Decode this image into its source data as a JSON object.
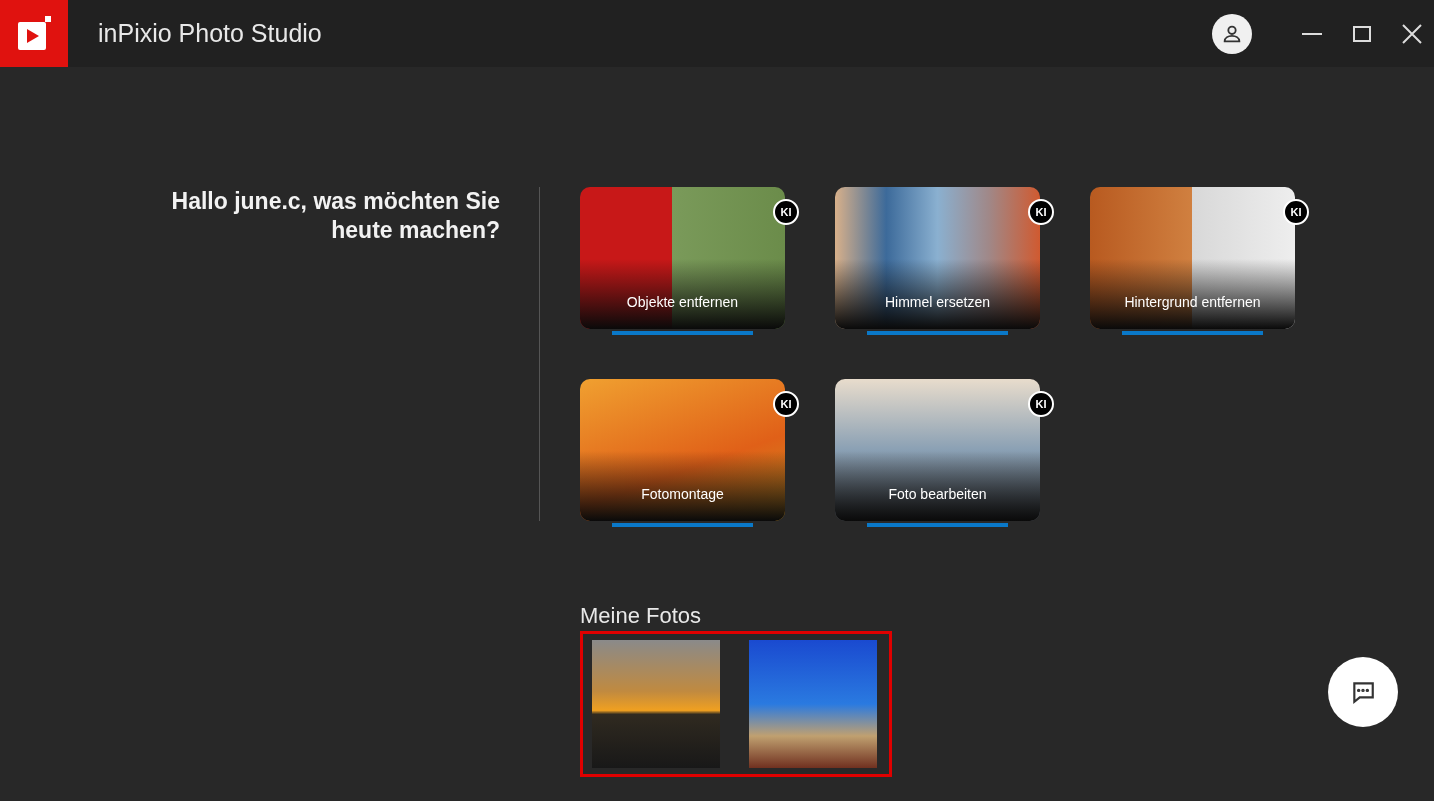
{
  "window": {
    "title": "inPixio Photo Studio"
  },
  "greeting": "Hallo june.c, was möchten Sie heute machen?",
  "tools": [
    {
      "label": "Objekte entfernen",
      "badge": "KI"
    },
    {
      "label": "Himmel ersetzen",
      "badge": "KI"
    },
    {
      "label": "Hintergrund entfernen",
      "badge": "KI"
    },
    {
      "label": "Fotomontage",
      "badge": "KI"
    },
    {
      "label": "Foto bearbeiten",
      "badge": "KI"
    }
  ],
  "my_photos": {
    "title": "Meine Fotos",
    "highlighted": true,
    "photos": [
      {
        "kind": "sunset"
      },
      {
        "kind": "umbrellas"
      }
    ]
  }
}
